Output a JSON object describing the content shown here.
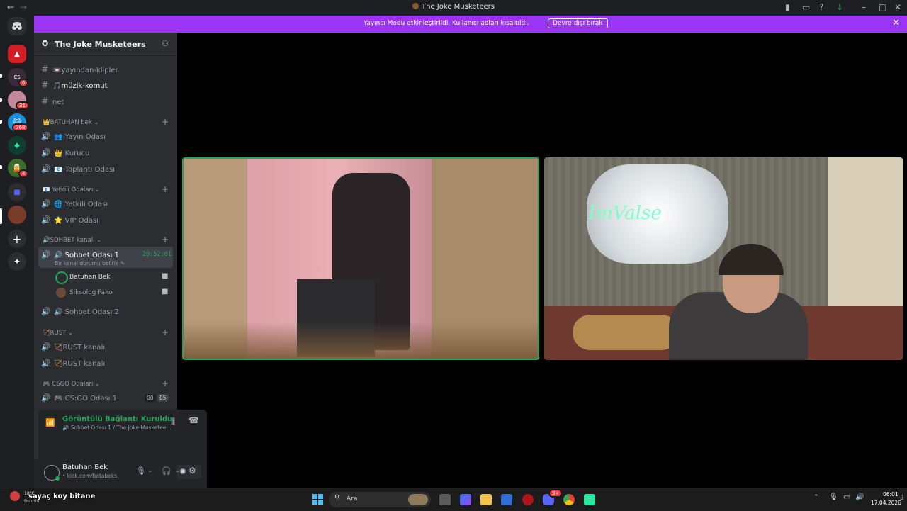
{
  "window": {
    "title": "The Joke Musketeers"
  },
  "notice": {
    "message": "Yayıncı Modu etkinleştirildi. Kullanıcı adları kısaltıldı.",
    "button": "Devre dışı bırak"
  },
  "rail": {
    "badges": [
      "6",
      "31",
      "268",
      "4"
    ]
  },
  "server": {
    "name": "The Joke Musketeers"
  },
  "channels": {
    "text": [
      "📼yayından-klipler",
      "🎵müzik-komut",
      "net"
    ],
    "cat_batuhan": "👑BATUHAN bek",
    "batuhan_items": [
      "👥 Yayın Odası",
      "👑 Kurucu",
      "📧 Toplantı Odası"
    ],
    "cat_yetkili": "📧 Yetkili Odaları",
    "yetkili_items": [
      "🌐 Yetkili Odası",
      "⭐ VIP Odası"
    ],
    "cat_sohbet": "🔊SOHBET kanalı",
    "sohbet1": "🔊 Sohbet Odası 1",
    "sohbet1_time": "20:52:01",
    "sohbet1_status": "Bir kanal durumu belirle",
    "members": [
      "Batuhan Bek",
      "Siksolog Fako"
    ],
    "sohbet2": "🔊 Sohbet Odası 2",
    "cat_rust": "🏹RUST",
    "rust_items": [
      "🏹RUST kanalı",
      "🏹RUST kanalı"
    ],
    "cat_csgo": "🎮 CSGO Odaları",
    "csgo1": "🎮 CS:GO Odası 1",
    "csgo1_counts": [
      "00",
      "05"
    ]
  },
  "voice": {
    "status": "Görüntülü Bağlantı Kuruldu",
    "location": "Sohbet Odası 1 / The Joke Musketee..."
  },
  "user": {
    "name": "Batuhan Bek",
    "status": "• kick.com/batabeks"
  },
  "taskbar": {
    "weather_temp": "18°C",
    "weather_text": "Bulutlu",
    "notification": "sayaç koy bitane",
    "search": "Ara",
    "time": "06:01",
    "date": "17.04.2026",
    "chrome_badge": "9+"
  },
  "tiles": {
    "left_label": "ImValse"
  },
  "colors": {
    "accent": "#9b35f5",
    "speaking": "#23a55a"
  }
}
